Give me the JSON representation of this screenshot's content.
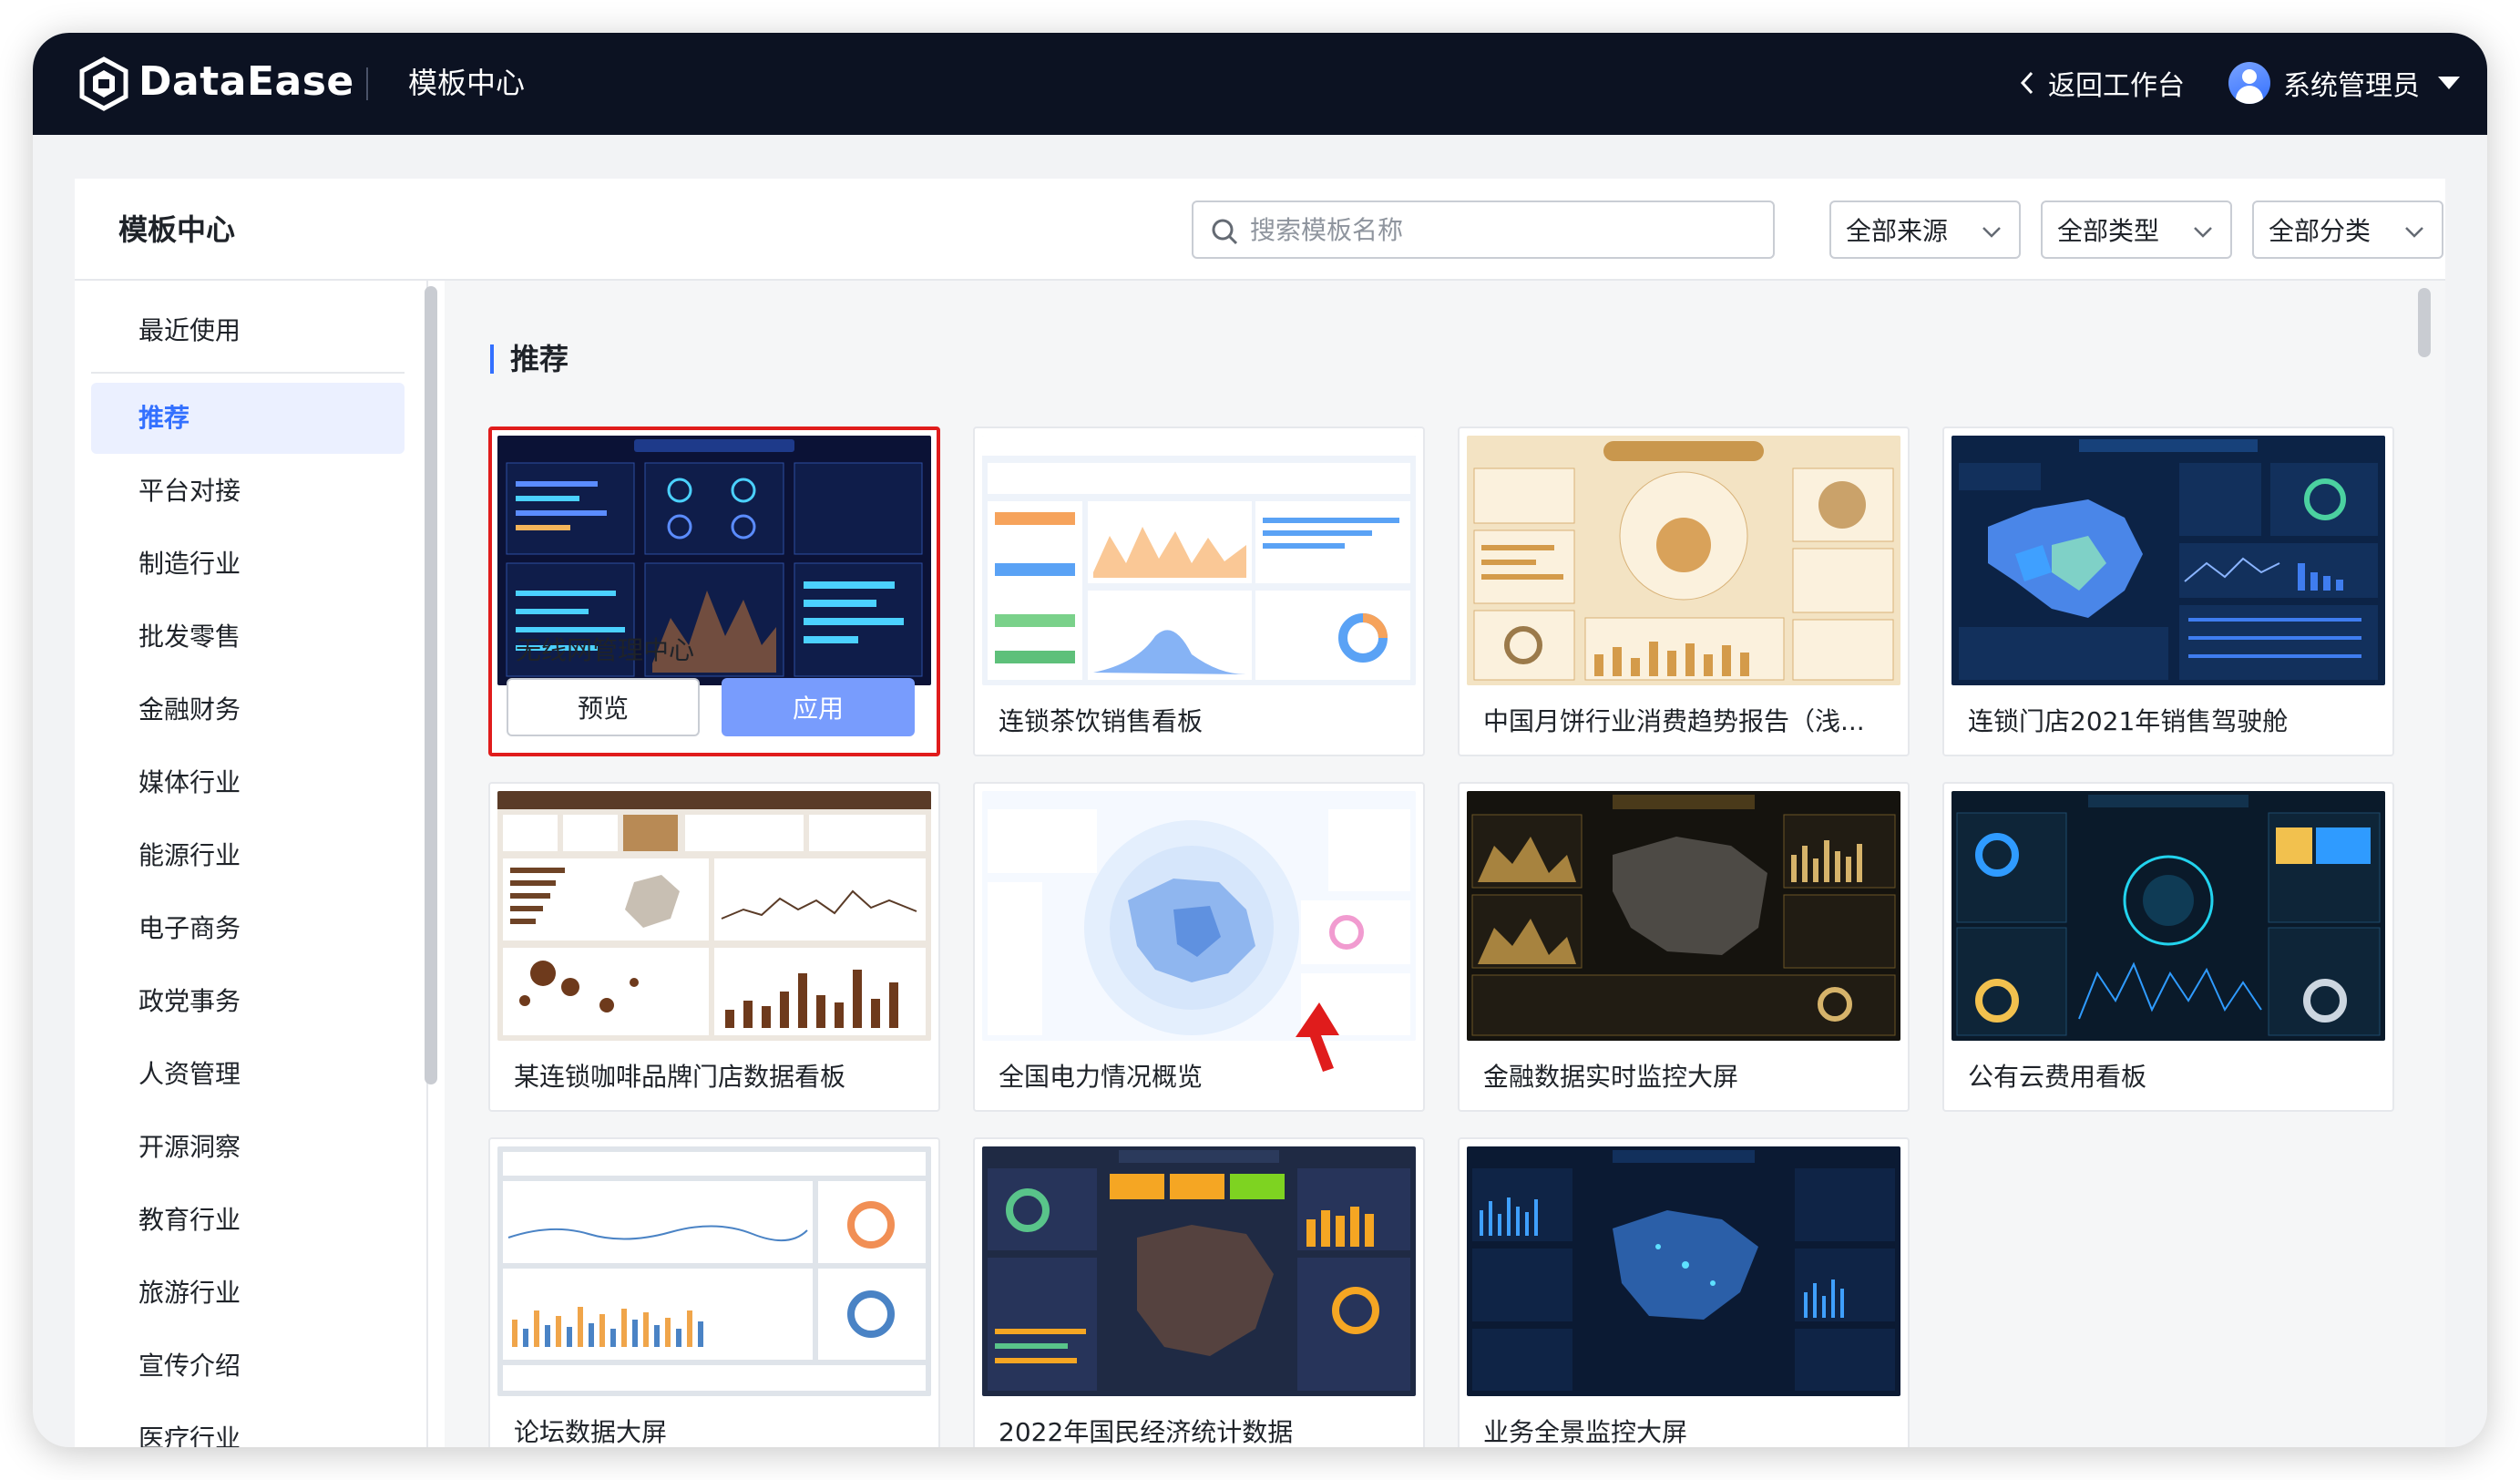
{
  "app": {
    "brand": "DataEase",
    "title": "模板中心"
  },
  "topbar": {
    "back_label": "返回工作台",
    "user_name": "系统管理员"
  },
  "panel": {
    "title": "模板中心"
  },
  "search": {
    "placeholder": "搜索模板名称",
    "value": ""
  },
  "filters": {
    "source": "全部来源",
    "type": "全部类型",
    "category": "全部分类"
  },
  "sidebar": {
    "active": "推荐",
    "items": [
      "最近使用",
      "推荐",
      "平台对接",
      "制造行业",
      "批发零售",
      "金融财务",
      "媒体行业",
      "能源行业",
      "电子商务",
      "政党事务",
      "人资管理",
      "开源洞察",
      "教育行业",
      "旅游行业",
      "宣传介绍",
      "医疗行业"
    ]
  },
  "section": {
    "title": "推荐"
  },
  "templates": [
    {
      "name": "无线网管理中心",
      "theme": "dark-blue"
    },
    {
      "name": "连锁茶饮销售看板",
      "theme": "light"
    },
    {
      "name": "中国月饼行业消费趋势报告（浅...",
      "theme": "beige"
    },
    {
      "name": "连锁门店2021年销售驾驶舱",
      "theme": "navy-map"
    },
    {
      "name": "某连锁咖啡品牌门店数据看板",
      "theme": "coffee"
    },
    {
      "name": "全国电力情况概览",
      "theme": "light-map"
    },
    {
      "name": "金融数据实时监控大屏",
      "theme": "dark-gold"
    },
    {
      "name": "公有云费用看板",
      "theme": "dark-teal"
    },
    {
      "name": "论坛数据大屏",
      "theme": "grey"
    },
    {
      "name": "2022年国民经济统计数据",
      "theme": "dark-slate"
    },
    {
      "name": "业务全景监控大屏",
      "theme": "dark-blue2"
    }
  ],
  "card_actions": {
    "preview": "预览",
    "apply": "应用"
  },
  "colors": {
    "topbar": "#0c1222",
    "accent": "#3370ff",
    "apply_button": "#789cfd",
    "selected_border": "#e01c1c"
  }
}
